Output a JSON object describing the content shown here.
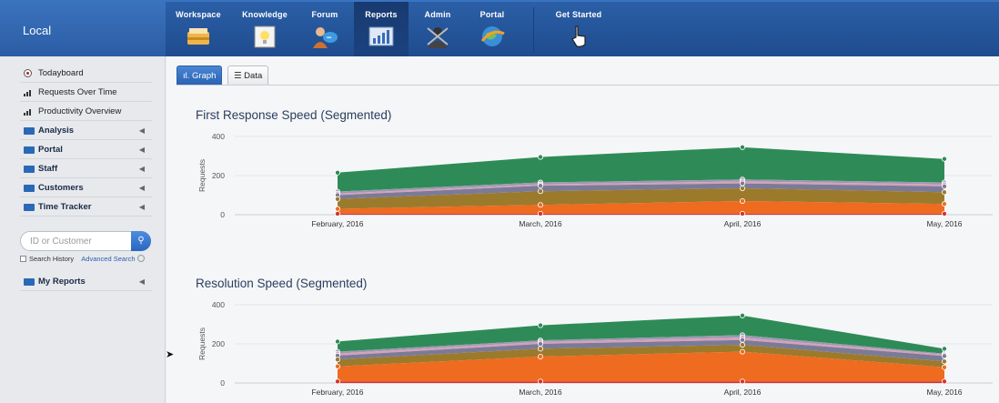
{
  "brand": "Local",
  "nav": [
    {
      "label": "Workspace",
      "icon": "workspace-icon"
    },
    {
      "label": "Knowledge",
      "icon": "knowledge-icon"
    },
    {
      "label": "Forum",
      "icon": "forum-icon"
    },
    {
      "label": "Reports",
      "icon": "reports-icon",
      "active": true
    },
    {
      "label": "Admin",
      "icon": "admin-icon"
    },
    {
      "label": "Portal",
      "icon": "portal-icon"
    },
    {
      "label": "Get Started",
      "icon": "pointer-hand-icon"
    }
  ],
  "sidebar": {
    "items": [
      {
        "label": "Todayboard",
        "icon": "radio-icon"
      },
      {
        "label": "Requests Over Time",
        "icon": "bar-chart-icon"
      },
      {
        "label": "Productivity Overview",
        "icon": "bar-chart-icon"
      },
      {
        "label": "Analysis",
        "icon": "folder-icon",
        "expandable": true
      },
      {
        "label": "Portal",
        "icon": "folder-icon",
        "expandable": true
      },
      {
        "label": "Staff",
        "icon": "folder-icon",
        "expandable": true
      },
      {
        "label": "Customers",
        "icon": "folder-icon",
        "expandable": true
      },
      {
        "label": "Time Tracker",
        "icon": "folder-icon",
        "expandable": true
      }
    ],
    "search": {
      "placeholder": "ID or Customer",
      "history_label": "Search History",
      "advanced_label": "Advanced Search"
    },
    "my_reports": "My Reports"
  },
  "tabs": [
    {
      "label": "Graph",
      "active": true
    },
    {
      "label": "Data",
      "active": false
    }
  ],
  "colors": {
    "green": "#2e8b57",
    "gray": "#8c8ca6",
    "pink": "#d7a0b8",
    "brown": "#9c7a2c",
    "orange": "#ee6b20",
    "red": "#d9332b"
  },
  "chart_data": [
    {
      "type": "area",
      "title": "First Response Speed (Segmented)",
      "ylabel": "Requests",
      "ylim": [
        0,
        400
      ],
      "yticks": [
        0,
        200,
        400
      ],
      "categories": [
        "February, 2016",
        "March, 2016",
        "April, 2016",
        "May, 2016"
      ],
      "stacked_levels": [
        {
          "color": "#2e8b57",
          "values": [
            215,
            295,
            345,
            285
          ]
        },
        {
          "color": "#9a9ab2",
          "values": [
            118,
            165,
            180,
            165
          ]
        },
        {
          "color": "#d7a0b8",
          "values": [
            108,
            155,
            170,
            155
          ]
        },
        {
          "color": "#7b7b98",
          "values": [
            100,
            148,
            160,
            145
          ]
        },
        {
          "color": "#9c7a2c",
          "values": [
            80,
            120,
            135,
            115
          ]
        },
        {
          "color": "#ee6b20",
          "values": [
            30,
            50,
            70,
            55
          ]
        },
        {
          "color": "#d9332b",
          "values": [
            5,
            5,
            5,
            5
          ]
        }
      ]
    },
    {
      "type": "area",
      "title": "Resolution Speed (Segmented)",
      "ylabel": "Requests",
      "ylim": [
        0,
        400
      ],
      "yticks": [
        0,
        200,
        400
      ],
      "categories": [
        "February, 2016",
        "March, 2016",
        "April, 2016",
        "May, 2016"
      ],
      "stacked_levels": [
        {
          "color": "#2e8b57",
          "values": [
            212,
            295,
            345,
            175
          ]
        },
        {
          "color": "#9a9ab2",
          "values": [
            160,
            218,
            245,
            150
          ]
        },
        {
          "color": "#d7a0b8",
          "values": [
            150,
            210,
            232,
            145
          ]
        },
        {
          "color": "#7b7b98",
          "values": [
            140,
            200,
            220,
            138
          ]
        },
        {
          "color": "#9c7a2c",
          "values": [
            120,
            175,
            195,
            110
          ]
        },
        {
          "color": "#ee6b20",
          "values": [
            85,
            135,
            160,
            80
          ]
        },
        {
          "color": "#d9332b",
          "values": [
            8,
            8,
            8,
            8
          ]
        }
      ]
    }
  ]
}
